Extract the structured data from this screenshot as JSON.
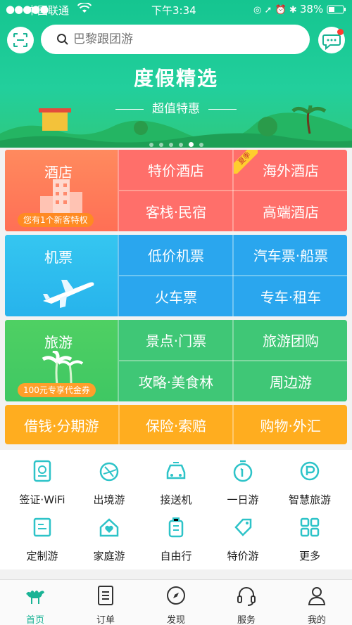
{
  "status_bar": {
    "signal": "●●●●●",
    "carrier": "中国联通",
    "time": "下午3:34",
    "battery": "38%"
  },
  "search": {
    "placeholder": "巴黎跟团游"
  },
  "banner": {
    "title": "度假精选",
    "subtitle": "超值特惠",
    "pages": 6,
    "active_page": 4
  },
  "hotel": {
    "main": "酒店",
    "badge": "您有1个新客特权",
    "items": [
      "特价酒店",
      "海外酒店",
      "客栈·民宿",
      "高端酒店"
    ],
    "tag": "夏季"
  },
  "flight": {
    "main": "机票",
    "items": [
      "低价机票",
      "汽车票·船票",
      "火车票",
      "专车·租车"
    ]
  },
  "travel": {
    "main": "旅游",
    "badge": "100元专享代金券",
    "items": [
      "景点·门票",
      "旅游团购",
      "攻略·美食林",
      "周边游"
    ]
  },
  "finance": {
    "items": [
      "借钱·分期游",
      "保险·索赔",
      "购物·外汇"
    ]
  },
  "shortcuts": [
    {
      "label": "签证·WiFi",
      "icon": "visa-icon"
    },
    {
      "label": "出境游",
      "icon": "outbound-icon"
    },
    {
      "label": "接送机",
      "icon": "car-icon"
    },
    {
      "label": "一日游",
      "icon": "one-day-icon"
    },
    {
      "label": "智慧旅游",
      "icon": "smart-travel-icon"
    },
    {
      "label": "定制游",
      "icon": "custom-tour-icon"
    },
    {
      "label": "家庭游",
      "icon": "family-icon"
    },
    {
      "label": "自由行",
      "icon": "luggage-icon"
    },
    {
      "label": "特价游",
      "icon": "price-tag-icon"
    },
    {
      "label": "更多",
      "icon": "grid-icon"
    }
  ],
  "tabs": [
    {
      "label": "首页",
      "icon": "camel-icon",
      "active": true
    },
    {
      "label": "订单",
      "icon": "order-icon"
    },
    {
      "label": "发现",
      "icon": "compass-icon"
    },
    {
      "label": "服务",
      "icon": "headset-icon"
    },
    {
      "label": "我的",
      "icon": "user-icon"
    }
  ],
  "colors": {
    "brand": "#19b395",
    "hotel": "#ff6f6a",
    "flight": "#2aa6ee",
    "travel": "#3fc776",
    "finance": "#ffad1f",
    "icon": "#2dc3c8"
  }
}
